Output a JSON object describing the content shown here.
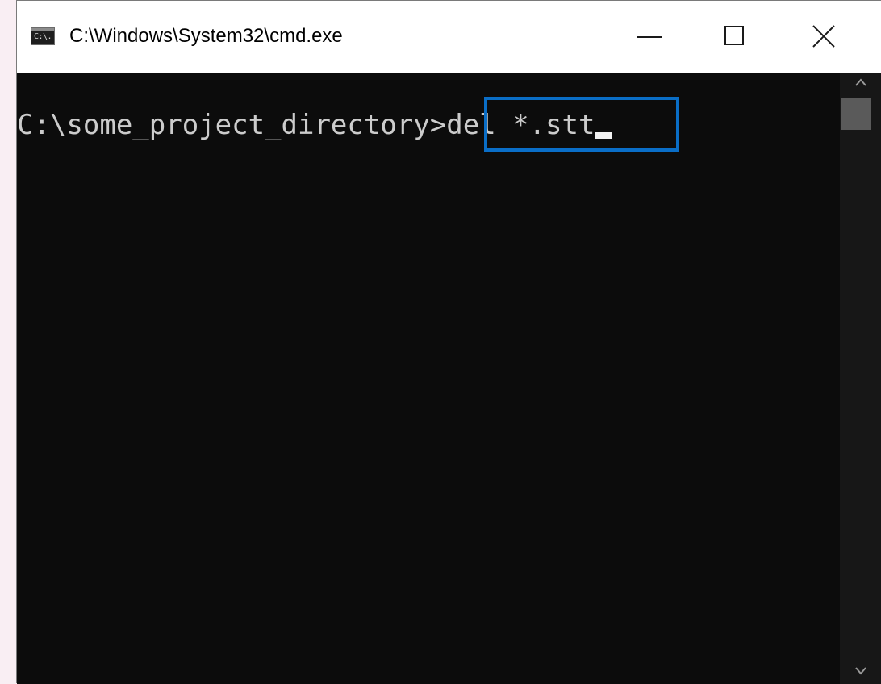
{
  "window": {
    "title": "C:\\Windows\\System32\\cmd.exe",
    "icon": {
      "name": "cmd-icon",
      "glyph": "C:\\."
    },
    "controls": {
      "minimize": "minimize-icon",
      "maximize": "maximize-icon",
      "close": "close-icon"
    }
  },
  "console": {
    "prompt": "C:\\some_project_directory>",
    "command": "del *.stt",
    "highlight_color": "#0a6ec7",
    "background": "#0c0c0c",
    "text_color": "#cccccc"
  },
  "scrollbar": {
    "up_icon": "chevron-up-icon",
    "down_icon": "chevron-down-icon"
  }
}
